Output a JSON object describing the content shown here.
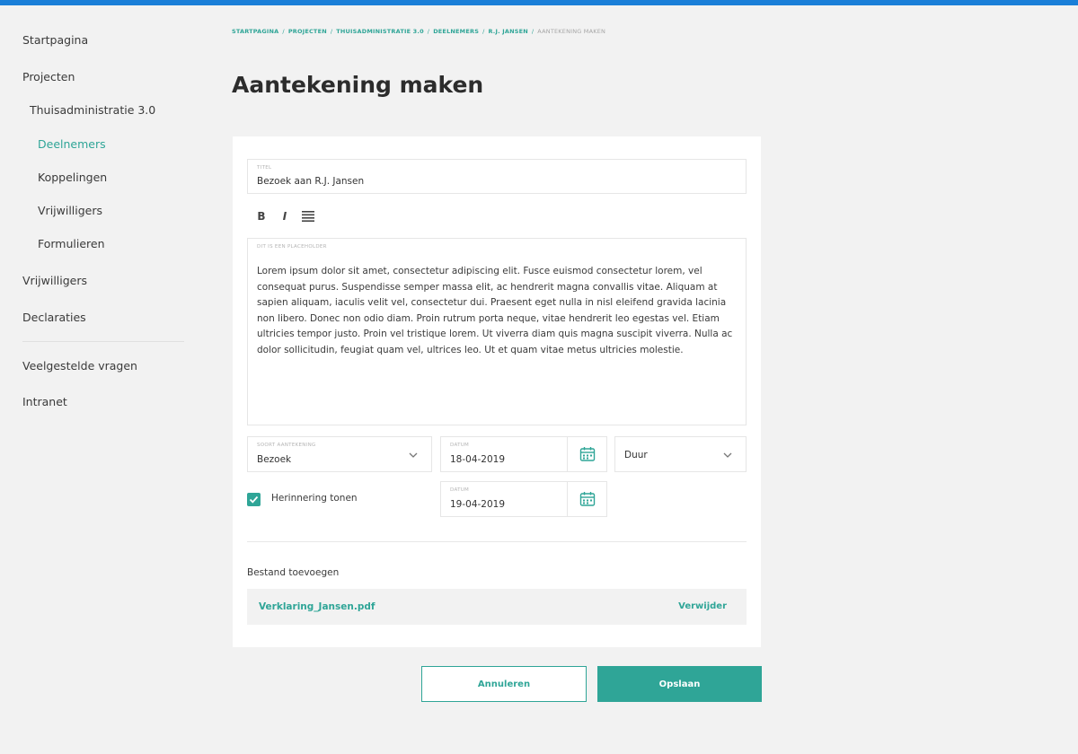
{
  "sidebar": {
    "items": [
      {
        "label": "Startpagina"
      },
      {
        "label": "Projecten"
      },
      {
        "label": "Thuisadministratie 3.0"
      },
      {
        "label": "Deelnemers"
      },
      {
        "label": "Koppelingen"
      },
      {
        "label": "Vrijwilligers"
      },
      {
        "label": "Formulieren"
      },
      {
        "label": "Vrijwilligers"
      },
      {
        "label": "Declaraties"
      },
      {
        "label": "Veelgestelde vragen"
      },
      {
        "label": "Intranet"
      }
    ]
  },
  "breadcrumb": {
    "items": [
      "STARTPAGINA",
      "PROJECTEN",
      "THUISADMINISTRATIE 3.0",
      "DEELNEMERS",
      "R.J. JANSEN"
    ],
    "current": "AANTEKENING MAKEN",
    "separator": "/"
  },
  "page": {
    "title": "Aantekening maken"
  },
  "form": {
    "title_field": {
      "label": "TITEL",
      "value": "Bezoek aan R.J. Jansen"
    },
    "toolbar": {
      "bold": "B",
      "italic": "I"
    },
    "editor": {
      "label": "DIT IS EEN PLACEHOLDER",
      "text": "Lorem ipsum dolor sit amet, consectetur adipiscing elit. Fusce euismod consectetur lorem, vel consequat purus. Suspendisse semper massa elit, ac hendrerit magna convallis vitae. Aliquam at sapien aliquam, iaculis velit vel, consectetur dui. Praesent eget nulla in nisl eleifend gravida lacinia non libero. Donec non odio diam. Proin rutrum porta neque, vitae hendrerit leo egestas vel. Etiam ultricies tempor justo. Proin vel tristique lorem. Ut viverra diam quis magna suscipit viverra. Nulla ac dolor sollicitudin, feugiat quam vel, ultrices leo. Ut et quam vitae metus ultricies molestie."
    },
    "type_field": {
      "label": "SOORT AANTEKENING",
      "value": "Bezoek"
    },
    "date_field": {
      "label": "DATUM",
      "value": "18-04-2019"
    },
    "duration_field": {
      "value": "Duur"
    },
    "reminder": {
      "label": "Herinnering tonen",
      "checked": true
    },
    "reminder_date": {
      "label": "DATUM",
      "value": "19-04-2019"
    },
    "attachment": {
      "title": "Bestand toevoegen",
      "file_name": "Verklaring_Jansen.pdf",
      "remove_label": "Verwijder"
    }
  },
  "actions": {
    "cancel_label": "Annuleren",
    "save_label": "Opslaan"
  },
  "colors": {
    "accent": "#2fa597",
    "topbar": "#1a7fd8",
    "background": "#f2f2f2"
  }
}
